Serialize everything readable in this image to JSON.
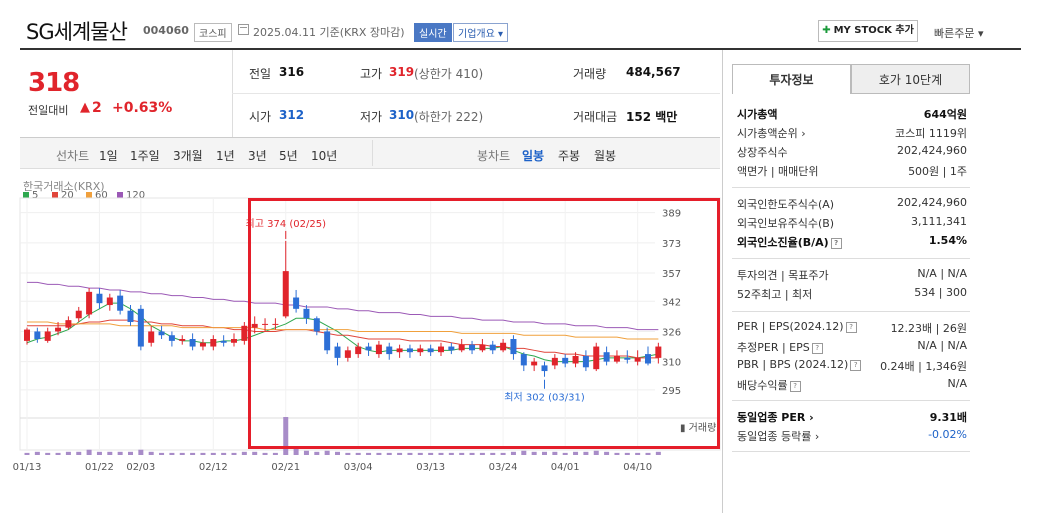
{
  "header": {
    "company_name": "SG세계물산",
    "code": "004060",
    "market": "코스피",
    "base_date": "2025.04.11 기준(KRX 장마감)",
    "realtime": "실시간",
    "corp_info": "기업개요 ▾",
    "mystock": "MY STOCK 추가",
    "quick_order": "빠른주문 ▾"
  },
  "price": {
    "current": "318",
    "change_label": "전일대비",
    "change_arrow": "▲",
    "change_value": "2",
    "change_pct": "+0.63%",
    "prev_close_label": "전일",
    "prev_close": "316",
    "high_label": "고가",
    "high": "319",
    "upper_limit": "(상한가 410)",
    "volume_label": "거래량",
    "volume": "484,567",
    "open_label": "시가",
    "open": "312",
    "low_label": "저가",
    "low": "310",
    "lower_limit": "(하한가 222)",
    "amount_label": "거래대금",
    "amount": "152 백만"
  },
  "tabs": {
    "line_label": "선차트",
    "line_items": [
      "1일",
      "1주일",
      "3개월",
      "1년",
      "3년",
      "5년",
      "10년"
    ],
    "candle_label": "봉차트",
    "candle_items": [
      "일봉",
      "주봉",
      "월봉"
    ],
    "selected_candle": "일봉"
  },
  "chart_meta": {
    "source": "한국거래소(KRX)",
    "legend": [
      {
        "label": "5",
        "color": "#2fa84f"
      },
      {
        "label": "20",
        "color": "#e0453a"
      },
      {
        "label": "60",
        "color": "#f0a03c"
      },
      {
        "label": "120",
        "color": "#9b59b6"
      }
    ],
    "volume_label": "거래량",
    "high_annotation": "최고 374 (02/25)",
    "low_annotation": "최저 302 (03/31)"
  },
  "chart_data": {
    "type": "candlestick",
    "ylim": [
      287,
      392
    ],
    "yticks": [
      389,
      373,
      357,
      342,
      326,
      310,
      295
    ],
    "x_tick_labels": [
      {
        "label": "01/13",
        "index": 0
      },
      {
        "label": "01/22",
        "index": 7
      },
      {
        "label": "02/03",
        "index": 11
      },
      {
        "label": "02/12",
        "index": 18
      },
      {
        "label": "02/21",
        "index": 25
      },
      {
        "label": "03/04",
        "index": 32
      },
      {
        "label": "03/13",
        "index": 39
      },
      {
        "label": "03/24",
        "index": 46
      },
      {
        "label": "04/01",
        "index": 52
      },
      {
        "label": "04/10",
        "index": 59
      }
    ],
    "candles": [
      {
        "o": 321,
        "c": 327,
        "h": 328,
        "l": 319
      },
      {
        "o": 326,
        "c": 322,
        "h": 328,
        "l": 320
      },
      {
        "o": 321,
        "c": 326,
        "h": 328,
        "l": 320
      },
      {
        "o": 326,
        "c": 328,
        "h": 331,
        "l": 324
      },
      {
        "o": 328,
        "c": 332,
        "h": 334,
        "l": 327
      },
      {
        "o": 333,
        "c": 337,
        "h": 339,
        "l": 331
      },
      {
        "o": 335,
        "c": 347,
        "h": 349,
        "l": 333
      },
      {
        "o": 346,
        "c": 341,
        "h": 349,
        "l": 338
      },
      {
        "o": 340,
        "c": 344,
        "h": 346,
        "l": 337
      },
      {
        "o": 345,
        "c": 337,
        "h": 348,
        "l": 335
      },
      {
        "o": 337,
        "c": 331,
        "h": 340,
        "l": 329
      },
      {
        "o": 338,
        "c": 318,
        "h": 340,
        "l": 316
      },
      {
        "o": 320,
        "c": 326,
        "h": 329,
        "l": 318
      },
      {
        "o": 326,
        "c": 324,
        "h": 329,
        "l": 322
      },
      {
        "o": 324,
        "c": 321,
        "h": 326,
        "l": 318
      },
      {
        "o": 321,
        "c": 322,
        "h": 324,
        "l": 319
      },
      {
        "o": 322,
        "c": 318,
        "h": 325,
        "l": 316
      },
      {
        "o": 318,
        "c": 320,
        "h": 322,
        "l": 316
      },
      {
        "o": 318,
        "c": 322,
        "h": 324,
        "l": 316
      },
      {
        "o": 321,
        "c": 320,
        "h": 324,
        "l": 318
      },
      {
        "o": 320,
        "c": 322,
        "h": 325,
        "l": 318
      },
      {
        "o": 321,
        "c": 329,
        "h": 331,
        "l": 319
      },
      {
        "o": 328,
        "c": 330,
        "h": 334,
        "l": 325
      },
      {
        "o": 330,
        "c": 330,
        "h": 333,
        "l": 326
      },
      {
        "o": 330,
        "c": 330,
        "h": 333,
        "l": 327
      },
      {
        "o": 334,
        "c": 358,
        "h": 374,
        "l": 333
      },
      {
        "o": 344,
        "c": 338,
        "h": 348,
        "l": 336
      },
      {
        "o": 338,
        "c": 333,
        "h": 340,
        "l": 330
      },
      {
        "o": 333,
        "c": 326,
        "h": 334,
        "l": 324
      },
      {
        "o": 326,
        "c": 316,
        "h": 328,
        "l": 314
      },
      {
        "o": 318,
        "c": 312,
        "h": 320,
        "l": 308
      },
      {
        "o": 312,
        "c": 316,
        "h": 318,
        "l": 310
      },
      {
        "o": 314,
        "c": 318,
        "h": 320,
        "l": 312
      },
      {
        "o": 318,
        "c": 316,
        "h": 320,
        "l": 313
      },
      {
        "o": 314,
        "c": 319,
        "h": 321,
        "l": 312
      },
      {
        "o": 318,
        "c": 314,
        "h": 320,
        "l": 311
      },
      {
        "o": 315,
        "c": 317,
        "h": 319,
        "l": 312
      },
      {
        "o": 317,
        "c": 315,
        "h": 319,
        "l": 312
      },
      {
        "o": 315,
        "c": 317,
        "h": 319,
        "l": 313
      },
      {
        "o": 317,
        "c": 315,
        "h": 319,
        "l": 313
      },
      {
        "o": 315,
        "c": 318,
        "h": 320,
        "l": 313
      },
      {
        "o": 318,
        "c": 316,
        "h": 320,
        "l": 314
      },
      {
        "o": 316,
        "c": 319,
        "h": 322,
        "l": 315
      },
      {
        "o": 319,
        "c": 316,
        "h": 321,
        "l": 314
      },
      {
        "o": 316,
        "c": 319,
        "h": 322,
        "l": 315
      },
      {
        "o": 319,
        "c": 316,
        "h": 321,
        "l": 314
      },
      {
        "o": 316,
        "c": 320,
        "h": 322,
        "l": 315
      },
      {
        "o": 322,
        "c": 314,
        "h": 324,
        "l": 311
      },
      {
        "o": 314,
        "c": 308,
        "h": 315,
        "l": 305
      },
      {
        "o": 308,
        "c": 310,
        "h": 312,
        "l": 305
      },
      {
        "o": 308,
        "c": 305,
        "h": 310,
        "l": 302
      },
      {
        "o": 308,
        "c": 312,
        "h": 314,
        "l": 306
      },
      {
        "o": 312,
        "c": 309,
        "h": 314,
        "l": 307
      },
      {
        "o": 309,
        "c": 313,
        "h": 315,
        "l": 307
      },
      {
        "o": 313,
        "c": 307,
        "h": 316,
        "l": 305
      },
      {
        "o": 306,
        "c": 318,
        "h": 320,
        "l": 305
      },
      {
        "o": 315,
        "c": 310,
        "h": 318,
        "l": 308
      },
      {
        "o": 310,
        "c": 313,
        "h": 316,
        "l": 309
      },
      {
        "o": 312,
        "c": 311,
        "h": 316,
        "l": 309
      },
      {
        "o": 310,
        "c": 312,
        "h": 316,
        "l": 308
      },
      {
        "o": 314,
        "c": 309,
        "h": 318,
        "l": 308
      },
      {
        "o": 312,
        "c": 318,
        "h": 320,
        "l": 309
      }
    ],
    "ma": {
      "ma5": [
        320,
        322,
        323,
        325,
        327,
        331,
        335,
        338,
        341,
        341,
        338,
        334,
        329,
        326,
        323,
        321,
        321,
        320,
        320,
        321,
        321,
        322,
        324,
        326,
        328,
        330,
        333,
        333,
        332,
        329,
        326,
        322,
        318,
        316,
        315,
        316,
        316,
        316,
        316,
        316,
        316,
        316,
        317,
        317,
        317,
        317,
        318,
        316,
        314,
        313,
        311,
        310,
        310,
        310,
        310,
        311,
        312,
        312,
        312,
        312,
        313,
        314
      ],
      "ma20": [
        329,
        329,
        329,
        329,
        329,
        330,
        331,
        331,
        332,
        332,
        332,
        331,
        331,
        330,
        330,
        329,
        329,
        329,
        328,
        328,
        327,
        327,
        326,
        326,
        326,
        327,
        327,
        327,
        326,
        325,
        324,
        324,
        323,
        322,
        322,
        322,
        322,
        321,
        321,
        321,
        321,
        320,
        319,
        319,
        319,
        318,
        318,
        317,
        317,
        316,
        315,
        315,
        314,
        314,
        313,
        313,
        313,
        313,
        313,
        312,
        312,
        312
      ],
      "ma60": [
        331,
        331,
        331,
        330,
        330,
        330,
        330,
        330,
        330,
        329,
        329,
        329,
        329,
        329,
        329,
        328,
        328,
        328,
        328,
        328,
        328,
        328,
        328,
        327,
        327,
        327,
        327,
        327,
        327,
        327,
        327,
        327,
        326,
        326,
        326,
        326,
        326,
        326,
        326,
        326,
        326,
        326,
        325,
        325,
        325,
        325,
        325,
        325,
        324,
        324,
        324,
        324,
        324,
        323,
        323,
        323,
        323,
        323,
        322,
        322,
        322,
        322
      ],
      "ma120": [
        352,
        352,
        351,
        351,
        350,
        350,
        349,
        349,
        348,
        348,
        347,
        347,
        346,
        346,
        345,
        345,
        344,
        344,
        343,
        343,
        342,
        342,
        341,
        341,
        341,
        340,
        340,
        339,
        339,
        339,
        338,
        338,
        337,
        337,
        336,
        336,
        336,
        335,
        335,
        334,
        334,
        334,
        333,
        333,
        332,
        332,
        332,
        331,
        331,
        331,
        330,
        330,
        330,
        329,
        329,
        329,
        328,
        328,
        328,
        327,
        327,
        327
      ]
    },
    "volume": [
      2,
      3,
      2,
      2,
      3,
      3,
      5,
      3,
      3,
      3,
      3,
      5,
      3,
      2,
      2,
      2,
      2,
      2,
      2,
      2,
      2,
      3,
      3,
      2,
      2,
      36,
      8,
      4,
      3,
      4,
      3,
      2,
      2,
      2,
      2,
      2,
      2,
      2,
      2,
      2,
      2,
      2,
      2,
      2,
      2,
      2,
      2,
      3,
      4,
      3,
      3,
      3,
      2,
      3,
      3,
      4,
      3,
      2,
      2,
      2,
      2,
      3
    ]
  },
  "right_panel": {
    "tab1": "투자정보",
    "tab2": "호가 10단계",
    "rows1": [
      {
        "k": "시가총액",
        "v": "644억원",
        "bold": true
      },
      {
        "k": "시가총액순위 ›",
        "v": "코스피 1119위"
      },
      {
        "k": "상장주식수",
        "v": "202,424,960"
      },
      {
        "k": "액면가 | 매매단위",
        "v": "500원 | 1주"
      }
    ],
    "rows2": [
      {
        "k": "외국인한도주식수(A)",
        "v": "202,424,960"
      },
      {
        "k": "외국인보유주식수(B)",
        "v": "3,111,341"
      },
      {
        "k": "외국인소진율(B/A)",
        "v": "1.54%",
        "bold": true,
        "q": true
      }
    ],
    "rows3": [
      {
        "k": "투자의견 | 목표주가",
        "v": "N/A | N/A"
      },
      {
        "k": "52주최고 | 최저",
        "v": "534 | 300"
      }
    ],
    "rows4": [
      {
        "k": "PER | EPS(2024.12)",
        "v": "12.23배 | 26원",
        "q": true
      },
      {
        "k": "추정PER | EPS",
        "v": "N/A | N/A",
        "q": true
      },
      {
        "k": "PBR | BPS (2024.12)",
        "v": "0.24배 | 1,346원",
        "q": true
      },
      {
        "k": "배당수익률",
        "v": "N/A",
        "q": true
      }
    ],
    "rows5": [
      {
        "k": "동일업종 PER ›",
        "v": "9.31배",
        "bold": true
      },
      {
        "k": "동일업종 등락률 ›",
        "v": "-0.02%",
        "vcolor": "#1d62c8"
      }
    ]
  }
}
